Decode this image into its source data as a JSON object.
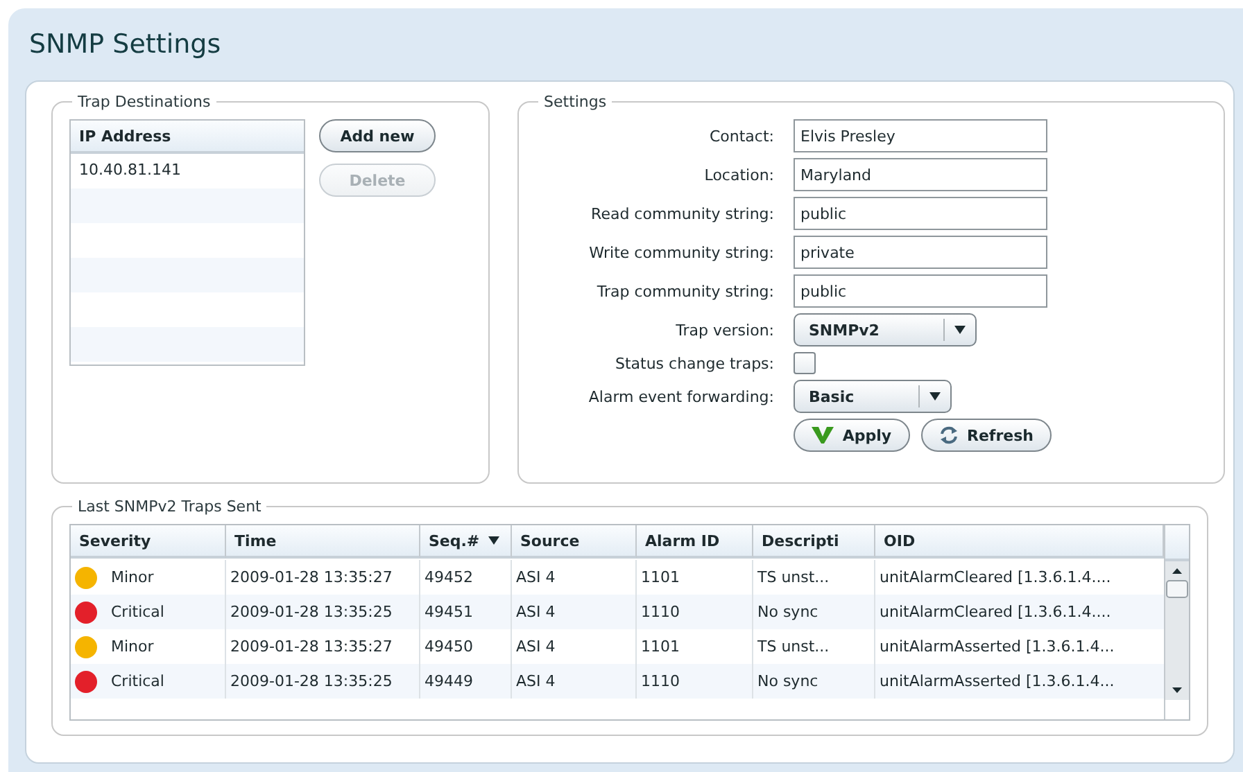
{
  "title": "SNMP Settings",
  "trap_destinations": {
    "legend": "Trap Destinations",
    "column": "IP Address",
    "rows": [
      "10.40.81.141"
    ],
    "buttons": [
      {
        "label": "Add new",
        "disabled": false
      },
      {
        "label": "Delete",
        "disabled": true
      }
    ]
  },
  "settings": {
    "legend": "Settings",
    "fields": [
      {
        "kind": "text",
        "label": "Contact:",
        "value": "Elvis Presley"
      },
      {
        "kind": "text",
        "label": "Location:",
        "value": "Maryland"
      },
      {
        "kind": "text",
        "label": "Read community string:",
        "value": "public"
      },
      {
        "kind": "text",
        "label": "Write community string:",
        "value": "private"
      },
      {
        "kind": "text",
        "label": "Trap community string:",
        "value": "public"
      },
      {
        "kind": "select",
        "label": "Trap version:",
        "value": "SNMPv2"
      },
      {
        "kind": "checkbox",
        "label": "Status change traps:",
        "checked": false
      },
      {
        "kind": "select",
        "label": "Alarm event forwarding:",
        "value": "Basic"
      }
    ],
    "buttons": [
      {
        "kind": "apply",
        "label": "Apply"
      },
      {
        "kind": "refresh",
        "label": "Refresh"
      }
    ]
  },
  "traps": {
    "legend": "Last SNMPv2 Traps Sent",
    "columns": [
      {
        "label": "Severity",
        "sorted": false
      },
      {
        "label": "Time",
        "sorted": false
      },
      {
        "label": "Seq.#",
        "sorted": true
      },
      {
        "label": "Source",
        "sorted": false
      },
      {
        "label": "Alarm ID",
        "sorted": false
      },
      {
        "label": "Descripti",
        "sorted": false
      },
      {
        "label": "OID",
        "sorted": false
      }
    ],
    "rows": [
      {
        "color": "#f5b400",
        "cells": [
          "Minor",
          "2009-01-28 13:35:27",
          "49452",
          "ASI 4",
          "1101",
          "TS unst...",
          "unitAlarmCleared [1.3.6.1.4...."
        ]
      },
      {
        "color": "#e3202a",
        "cells": [
          "Critical",
          "2009-01-28 13:35:25",
          "49451",
          "ASI 4",
          "1110",
          "No sync",
          "unitAlarmCleared [1.3.6.1.4...."
        ]
      },
      {
        "color": "#f5b400",
        "cells": [
          "Minor",
          "2009-01-28 13:35:27",
          "49450",
          "ASI 4",
          "1101",
          "TS unst...",
          "unitAlarmAsserted [1.3.6.1.4..."
        ]
      },
      {
        "color": "#e3202a",
        "cells": [
          "Critical",
          "2009-01-28 13:35:25",
          "49449",
          "ASI 4",
          "1110",
          "No sync",
          "unitAlarmAsserted [1.3.6.1.4..."
        ]
      }
    ]
  }
}
